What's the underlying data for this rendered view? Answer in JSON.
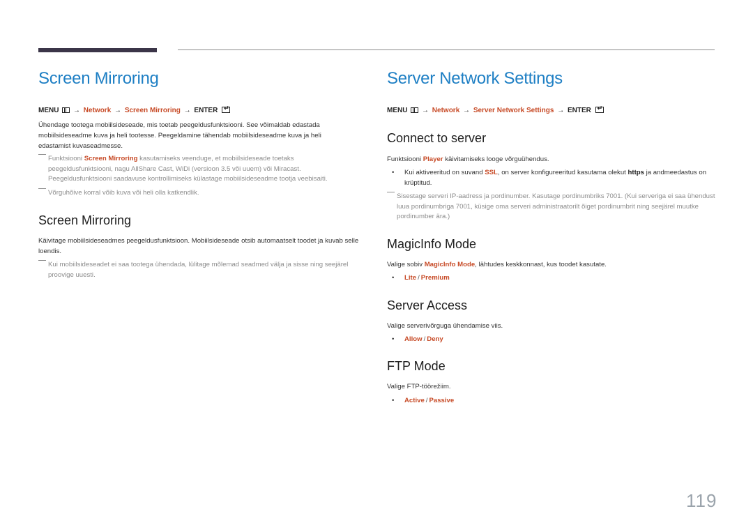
{
  "left": {
    "title": "Screen Mirroring",
    "menu_path": {
      "menu": "MENU",
      "arrow": "→",
      "items": [
        "Network",
        "Screen Mirroring"
      ],
      "enter": "ENTER"
    },
    "intro": "Ühendage tootega mobiilsideseade, mis toetab peegeldusfunktsiooni. See võimaldab edastada mobiilsideseadme kuva ja heli tootesse. Peegeldamine tähendab mobiilsideseadme kuva ja heli edastamist kuvaseadmesse.",
    "note1": {
      "before": "Funktsiooni ",
      "highlight": "Screen Mirroring",
      "after": " kasutamiseks veenduge, et mobiilsideseade toetaks peegeldusfunktsiooni, nagu AllShare Cast, WiDi (versioon 3.5 või uuem) või Miracast. Peegeldusfunktsiooni saadavuse kontrollimiseks külastage mobiilsideseadme tootja veebisaiti."
    },
    "note2": "Võrguhõive korral võib kuva või heli olla katkendlik.",
    "section": {
      "title": "Screen Mirroring",
      "body": "Käivitage mobiilsideseadmes peegeldusfunktsioon. Mobiilsideseade otsib automaatselt toodet ja kuvab selle loendis.",
      "note": "Kui mobiilsideseadet ei saa tootega ühendada, lülitage mõlemad seadmed välja ja sisse ning seejärel proovige uuesti."
    }
  },
  "right": {
    "title": "Server Network Settings",
    "menu_path": {
      "menu": "MENU",
      "arrow": "→",
      "items": [
        "Network",
        "Server Network Settings"
      ],
      "enter": "ENTER"
    },
    "connect": {
      "title": "Connect to server",
      "body_before": "Funktsiooni ",
      "body_highlight": "Player",
      "body_after": " käivitamiseks looge võrguühendus.",
      "bullet_before": "Kui aktiveeritud on suvand ",
      "bullet_ssl": "SSL",
      "bullet_mid": ", on server konfigureeritud kasutama olekut ",
      "bullet_https": "https",
      "bullet_after": " ja andmeedastus on krüptitud.",
      "note": "Sisestage serveri IP-aadress ja pordinumber. Kasutage pordinumbriks 7001. (Kui serveriga ei saa ühendust luua pordinumbriga 7001, küsige oma serveri administraatorilt õiget pordinumbrit ning seejärel muutke pordinumber ära.)"
    },
    "magicinfo": {
      "title": "MagicInfo Mode",
      "body_before": "Valige sobiv ",
      "body_highlight": "MagicInfo Mode",
      "body_after": ", lähtudes keskkonnast, kus toodet kasutate.",
      "options": [
        "Lite",
        "Premium"
      ]
    },
    "server_access": {
      "title": "Server Access",
      "body": "Valige serverivõrguga ühendamise viis.",
      "options": [
        "Allow",
        "Deny"
      ]
    },
    "ftp": {
      "title": "FTP Mode",
      "body": "Valige FTP-töörežiim.",
      "options": [
        "Active",
        "Passive"
      ]
    }
  },
  "bullet_glyph": "•",
  "option_separator": "/",
  "page_number": "119",
  "colors": {
    "title_blue": "#1e7fc4",
    "highlight_orange": "#c74a26",
    "note_gray": "#8c8c8c",
    "top_bar": "#3b3548"
  }
}
